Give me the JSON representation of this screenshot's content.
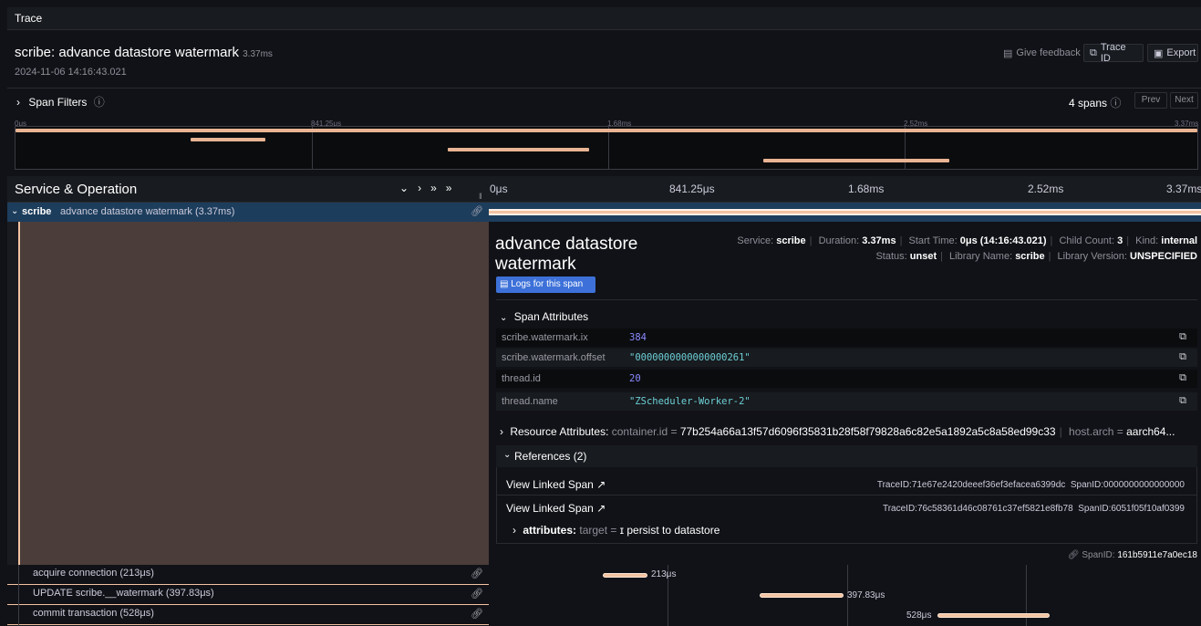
{
  "window": {
    "panel_title": "Trace"
  },
  "trace": {
    "title": "scribe: advance datastore watermark",
    "duration": "3.37ms",
    "timestamp": "2024-11-06 14:16:43.021"
  },
  "toolbar": {
    "feedback_label": "Give feedback",
    "trace_id_label": "Trace ID",
    "export_label": "Export"
  },
  "filters": {
    "label": "Span Filters",
    "span_count": "4 spans",
    "prev_label": "Prev",
    "next_label": "Next"
  },
  "minimap": {
    "ticks": [
      "0μs",
      "841.25μs",
      "1.68ms",
      "2.52ms",
      "3.37ms"
    ]
  },
  "timeline_header": {
    "title": "Service & Operation",
    "ticks": [
      "0μs",
      "841.25μs",
      "1.68ms",
      "2.52ms",
      "3.37ms"
    ]
  },
  "spans": [
    {
      "service": "scribe",
      "operation": "advance datastore watermark (3.37ms)",
      "start_fraction": 0.0,
      "duration_fraction": 1.0
    },
    {
      "label": "acquire connection (213μs)",
      "bar_label": "213μs",
      "start_fraction": 0.16,
      "duration_fraction": 0.063
    },
    {
      "label": "UPDATE scribe.__watermark (397.83μs)",
      "bar_label": "397.83μs",
      "start_fraction": 0.38,
      "duration_fraction": 0.118
    },
    {
      "label": "commit transaction (528μs)",
      "bar_label": "528μs",
      "start_fraction": 0.63,
      "duration_fraction": 0.157
    }
  ],
  "detail": {
    "title_line1": "advance datastore",
    "title_line2": "watermark",
    "logs_button": "Logs for this span",
    "meta_row1": {
      "service_k": "Service:",
      "service_v": "scribe",
      "duration_k": "Duration:",
      "duration_v": "3.37ms",
      "start_k": "Start Time:",
      "start_v": "0μs (14:16:43.021)",
      "child_k": "Child Count:",
      "child_v": "3",
      "kind_k": "Kind:",
      "kind_v": "internal"
    },
    "meta_row2": {
      "status_k": "Status:",
      "status_v": "unset",
      "libname_k": "Library Name:",
      "libname_v": "scribe",
      "libver_k": "Library Version:",
      "libver_v": "UNSPECIFIED"
    },
    "span_attributes_label": "Span Attributes",
    "attributes": [
      {
        "key": "scribe.watermark.ix",
        "value": "384",
        "type": "number"
      },
      {
        "key": "scribe.watermark.offset",
        "value": "\"0000000000000000261\"",
        "type": "string"
      },
      {
        "key": "thread.id",
        "value": "20",
        "type": "number"
      },
      {
        "key": "thread.name",
        "value": "\"ZScheduler-Worker-2\"",
        "type": "string"
      }
    ],
    "resource": {
      "label": "Resource Attributes:",
      "k1": "container.id",
      "v1": "77b254a66a13f57d6096f35831b28f58f79828a6c82e5a1892a5c8a58ed99c33",
      "k2": "host.arch",
      "v2": "aarch64..."
    },
    "references_label": "References (2)",
    "references": [
      {
        "label": "View Linked Span",
        "trace": "TraceID:71e67e2420deeef36ef3efacea6399dc",
        "span": "SpanID:0000000000000000"
      },
      {
        "label": "View Linked Span",
        "trace": "TraceID:76c58361d46c08761c37ef5821e8fb78",
        "span": "SpanID:6051f05f10af0399"
      }
    ],
    "ref_attrs": {
      "label": "attributes:",
      "k": "target",
      "v": "ɪ persist to datastore"
    },
    "span_id_k": "SpanID:",
    "span_id_v": "161b5911e7a0ec18"
  },
  "colors": {
    "accent": "#3d71d9",
    "span_bar": "#f2c3a2",
    "selected_row": "#1d3d5c",
    "detail_bg": "#4a3d3a",
    "number": "#8a8aff",
    "string": "#6ccfd6"
  }
}
